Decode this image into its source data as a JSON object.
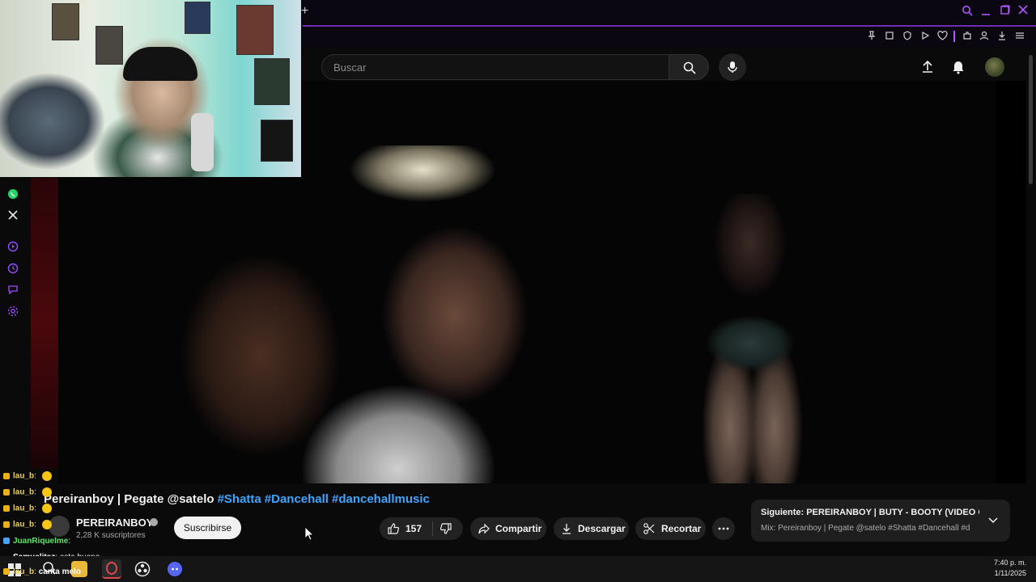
{
  "header": {
    "search_placeholder": "Buscar"
  },
  "video": {
    "title_prefix": "Pereiranboy | Pegate @satelo",
    "hashtags": [
      "#Shatta",
      "#Dancehall",
      "#dancehallmusic"
    ]
  },
  "channel": {
    "name": "PEREIRANBOY",
    "subscribers": "2,28 K suscriptores",
    "subscribe_label": "Suscribirse"
  },
  "actions": {
    "like_count": "157",
    "share_label": "Compartir",
    "download_label": "Descargar",
    "clip_label": "Recortar"
  },
  "next_up": {
    "title": "Siguiente: PEREIRANBOY | BUTY - BOOTY (VIDEO O...",
    "subtitle": "Mix: Pereiranboy | Pegate @satelo #Shatta #Dancehall #d"
  },
  "chat": [
    {
      "user": "lau_b",
      "text": ""
    },
    {
      "user": "lau_b",
      "text": ""
    },
    {
      "user": "lau_b",
      "text": ""
    },
    {
      "user": "lau_b",
      "text": ""
    },
    {
      "user": "JuanRiquelme",
      "text": ""
    },
    {
      "user": "Samuelitaz",
      "text": "esta bueno"
    },
    {
      "user": "lau_b",
      "text": "canta melo"
    }
  ],
  "taskbar": {
    "time": "7:40 p. m.",
    "date": "1/11/2025"
  },
  "colors": {
    "accent_purple": "#b056ff",
    "hashtag_blue": "#3ea6ff",
    "chat_user_yellow": "#f1d14a"
  }
}
